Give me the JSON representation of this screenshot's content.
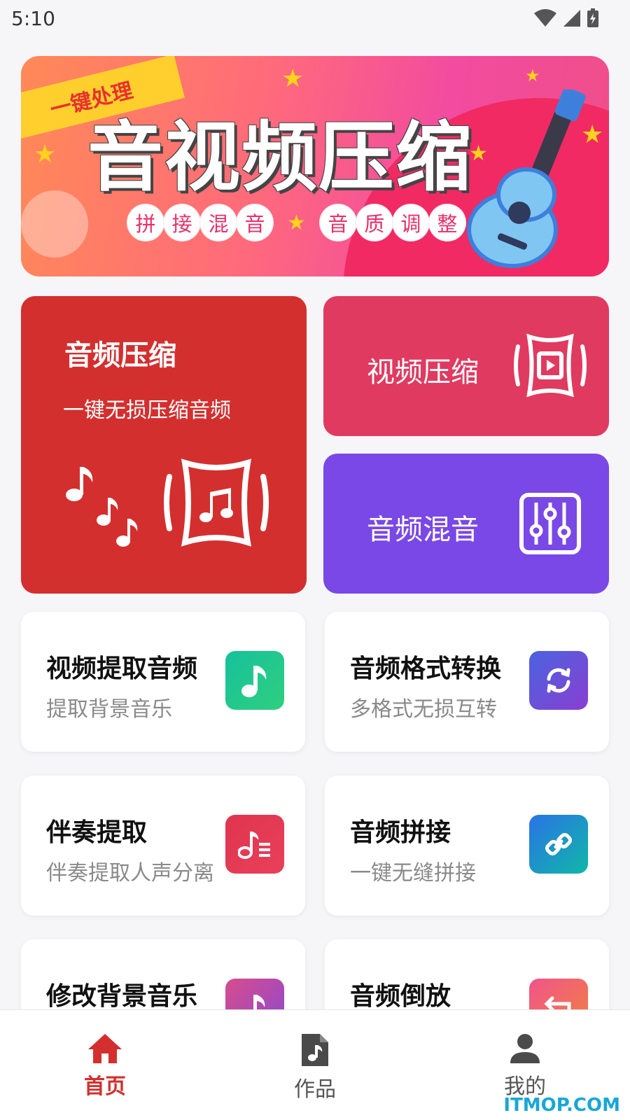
{
  "status_bar": {
    "time": "5:10"
  },
  "banner": {
    "ribbon": "一键处理",
    "headline": "音视频压缩",
    "pill_group_1": [
      "拼",
      "接",
      "混",
      "音"
    ],
    "pill_group_2": [
      "音",
      "质",
      "调",
      "整"
    ]
  },
  "features": {
    "audio_compress": {
      "title": "音频压缩",
      "subtitle": "一键无损压缩音频"
    },
    "video_compress": {
      "title": "视频压缩"
    },
    "audio_mix": {
      "title": "音频混音"
    }
  },
  "tools": [
    {
      "title": "视频提取音频",
      "subtitle": "提取背景音乐",
      "icon": "music-note-icon",
      "color_from": "#16c19b",
      "color_to": "#2fcf7f"
    },
    {
      "title": "音频格式转换",
      "subtitle": "多格式无损互转",
      "icon": "sync-icon",
      "color_from": "#4a63e0",
      "color_to": "#8a3fd0"
    },
    {
      "title": "伴奏提取",
      "subtitle": "伴奏提取人声分离",
      "icon": "playlist-icon",
      "color_from": "#e0344f",
      "color_to": "#e9405a"
    },
    {
      "title": "音频拼接",
      "subtitle": "一键无缝拼接",
      "icon": "link-icon",
      "color_from": "#2a73e6",
      "color_to": "#11b7a8"
    },
    {
      "title": "修改背景音乐",
      "subtitle": "",
      "icon": "music-note-icon",
      "color_from": "#d84c8a",
      "color_to": "#8a49d6"
    },
    {
      "title": "音频倒放",
      "subtitle": "",
      "icon": "reverse-icon",
      "color_from": "#f0548a",
      "color_to": "#f2833e"
    }
  ],
  "bottom_nav": [
    {
      "label": "首页",
      "active": true
    },
    {
      "label": "作品",
      "active": false
    },
    {
      "label": "我的",
      "active": false
    }
  ],
  "watermark": "ITMOP.COM",
  "colors": {
    "accent_red": "#d32f2f",
    "video_pink": "#e03a60",
    "mix_purple": "#7a48e6"
  }
}
